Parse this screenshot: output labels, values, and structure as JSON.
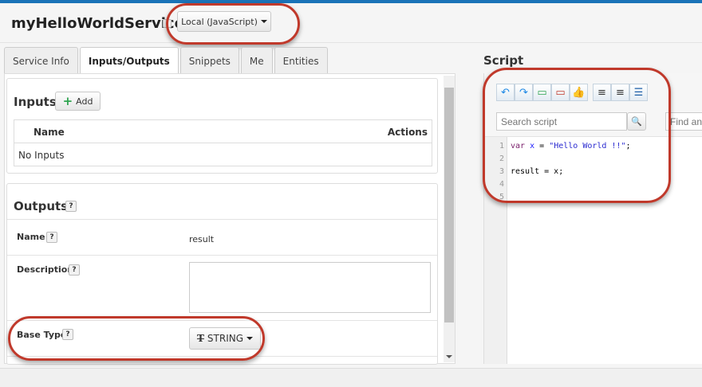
{
  "header": {
    "title": "myHelloWorldService",
    "handler_dropdown": "Local (JavaScript)"
  },
  "tabs": [
    {
      "label": "Service Info"
    },
    {
      "label": "Inputs/Outputs",
      "active": true
    },
    {
      "label": "Snippets"
    },
    {
      "label": "Me"
    },
    {
      "label": "Entities"
    }
  ],
  "inputs": {
    "heading": "Inputs",
    "add_label": "Add",
    "columns": [
      "Name",
      "Actions"
    ],
    "empty_text": "No Inputs"
  },
  "outputs": {
    "heading": "Outputs",
    "help": "?",
    "name_label": "Name",
    "name_value": "result",
    "description_label": "Description",
    "description_value": "",
    "base_type_label": "Base Type",
    "base_type_value": "STRING",
    "base_type_icon": "T"
  },
  "script": {
    "heading": "Script",
    "search_placeholder": "Search script",
    "find_placeholder": "Find and",
    "toolbar": [
      "undo-icon",
      "redo-icon",
      "add-snippet-icon",
      "remove-snippet-icon",
      "thumbs-up-icon",
      "indent-left-icon",
      "indent-right-icon",
      "format-icon"
    ],
    "lines": [
      {
        "n": "1",
        "tokens": [
          {
            "t": "var ",
            "c": "#7a1f6b"
          },
          {
            "t": "x",
            "c": "#1a1aff"
          },
          {
            "t": " = ",
            "c": "#000"
          },
          {
            "t": "\"Hello World !!\"",
            "c": "#2a2ad0"
          },
          {
            "t": ";",
            "c": "#000"
          }
        ]
      },
      {
        "n": "2",
        "tokens": []
      },
      {
        "n": "3",
        "tokens": [
          {
            "t": "result = x;",
            "c": "#000"
          }
        ]
      },
      {
        "n": "4",
        "tokens": []
      },
      {
        "n": "5",
        "tokens": []
      }
    ]
  },
  "colors": {
    "accent": "#1a73b8",
    "highlight": "#c0392b",
    "add_icon": "#2ea44f"
  }
}
